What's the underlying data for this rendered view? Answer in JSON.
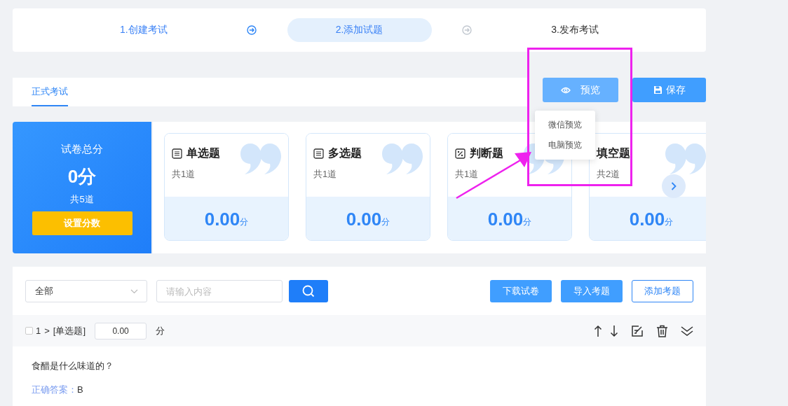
{
  "steps": [
    {
      "label": "1.创建考试",
      "completed": true,
      "selected": false
    },
    {
      "label": "2.添加试题",
      "completed": false,
      "selected": true
    },
    {
      "label": "3.发布考试",
      "completed": false,
      "selected": false
    }
  ],
  "tabs": [
    {
      "label": "正式考试",
      "selected": true
    }
  ],
  "actions": [
    {
      "label": "预览",
      "kind": "preview"
    },
    {
      "label": "保存",
      "kind": "save"
    }
  ],
  "preview_menu": {
    "items": [
      "微信预览",
      "电脑预览"
    ]
  },
  "summary": {
    "title": "试卷总分",
    "score": "0分",
    "count": "共5道",
    "button": "设置分数"
  },
  "type_cards": [
    {
      "kind": "list",
      "title": "单选题",
      "count": "共1道",
      "score": "0.00",
      "unit": "分"
    },
    {
      "kind": "list",
      "title": "多选题",
      "count": "共1道",
      "score": "0.00",
      "unit": "分"
    },
    {
      "kind": "judge",
      "title": "判断题",
      "count": "共1道",
      "score": "0.00",
      "unit": "分"
    },
    {
      "kind": "none",
      "title": "填空题",
      "count": "共2道",
      "score": "0.00",
      "unit": "分"
    }
  ],
  "filter": {
    "select": "全部",
    "placeholder": "请输入内容"
  },
  "toolbar_buttons": [
    {
      "label": "下载试卷",
      "kind": "filled"
    },
    {
      "label": "导入考题",
      "kind": "filled"
    },
    {
      "label": "添加考题",
      "kind": "outline"
    }
  ],
  "question": {
    "checked": false,
    "number": "1",
    "separator": ">",
    "type": "[单选题]",
    "score": "0.00",
    "unit": "分",
    "text": "食醋是什么味道的？",
    "answer_label": "正确答案：",
    "answer": "B"
  },
  "annotations": {
    "highlight_box": true,
    "pointer_arrow": true
  }
}
